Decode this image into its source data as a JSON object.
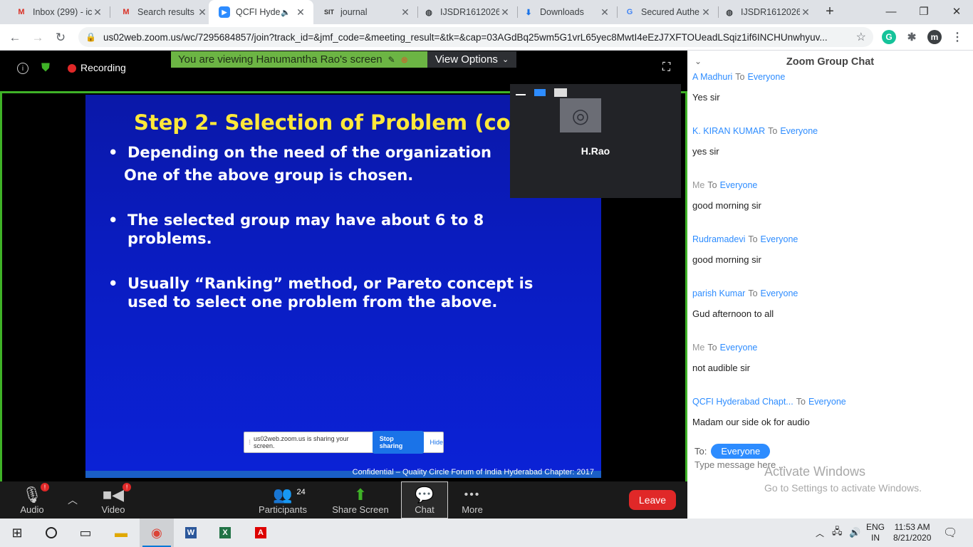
{
  "browser": {
    "tabs": [
      {
        "title": "Inbox (299) - ic",
        "icon": "gmail-icon",
        "active": false
      },
      {
        "title": "Search results",
        "icon": "gmail-icon",
        "active": false
      },
      {
        "title": "QCFI Hyde",
        "icon": "zoom-icon",
        "active": true
      },
      {
        "title": "journal",
        "icon": "sit-icon",
        "active": false
      },
      {
        "title": "IJSDR1612026",
        "icon": "globe-icon",
        "active": false
      },
      {
        "title": "Downloads",
        "icon": "download-icon",
        "active": false
      },
      {
        "title": "Secured Authe",
        "icon": "google-icon",
        "active": false
      },
      {
        "title": "IJSDR1612026",
        "icon": "globe-icon",
        "active": false
      }
    ],
    "url": "us02web.zoom.us/wc/7295684857/join?track_id=&jmf_code=&meeting_result=&tk=&cap=03AGdBq25wm5G1vrL65yec8MwtI4eEzJ7XFTOUeadLSqiz1if6INCHUnwhyuv...",
    "profile_initial": "m"
  },
  "zoom": {
    "recording_label": "Recording",
    "viewing_banner": "You are viewing Hanumantha Rao's screen",
    "view_options": "View Options",
    "thumbnail_name": "H.Rao",
    "share_notice": {
      "text": "us02web.zoom.us is sharing your screen.",
      "stop": "Stop sharing",
      "hide": "Hide"
    },
    "slide": {
      "title": "Step 2- Selection of Problem (contd.)",
      "bullets": [
        [
          "Depending on the need of the organization",
          "One of the above group is chosen."
        ],
        [
          "The selected group may have about 6 to 8",
          "problems."
        ],
        [
          "Usually “Ranking” method, or Pareto concept is",
          "used to select one problem from the above."
        ]
      ],
      "footer": "Confidential – Quality Circle Forum of India Hyderabad Chapter: 2017"
    },
    "toolbar": {
      "audio": "Audio",
      "video": "Video",
      "participants": "Participants",
      "participant_count": "24",
      "share": "Share Screen",
      "chat": "Chat",
      "more": "More",
      "leave": "Leave",
      "badge": "!"
    }
  },
  "chat": {
    "header": "Zoom Group Chat",
    "to_word": "To",
    "messages": [
      {
        "sender": "A Madhuri",
        "to": "Everyone",
        "text": "Yes sir"
      },
      {
        "sender": "K. KIRAN KUMAR",
        "to": "Everyone",
        "text": "yes sir"
      },
      {
        "sender": "Me",
        "to": "Everyone",
        "text": "good morning sir"
      },
      {
        "sender": "Rudramadevi",
        "to": "Everyone",
        "text": "good morning sir"
      },
      {
        "sender": "parish Kumar",
        "to": "Everyone",
        "text": "Gud afternoon to all"
      },
      {
        "sender": "Me",
        "to": "Everyone",
        "text": "not audible sir"
      },
      {
        "sender": "QCFI Hyderabad Chapt...",
        "to": "Everyone",
        "text": "Madam our side ok for audio"
      }
    ],
    "to_label": "To:",
    "to_target": "Everyone",
    "input_placeholder": "Type message here ..."
  },
  "watermark": {
    "line1": "Activate Windows",
    "line2": "Go to Settings to activate Windows."
  },
  "taskbar": {
    "lang1": "ENG",
    "lang2": "IN",
    "time": "11:53 AM",
    "date": "8/21/2020"
  },
  "colors": {
    "zoom_green": "#3fb227",
    "zoom_blue": "#2d8cff",
    "leave_red": "#e02828",
    "slide_title": "#ffe83a"
  }
}
